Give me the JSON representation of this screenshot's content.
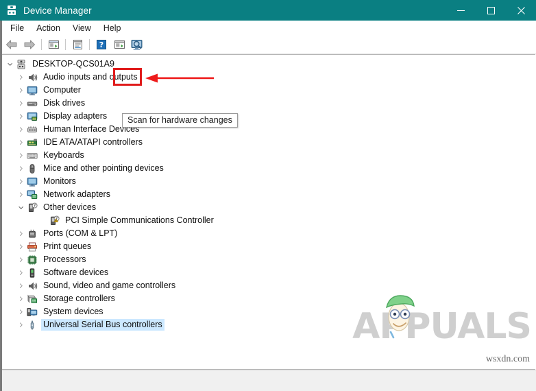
{
  "window": {
    "title": "Device Manager",
    "title_icon": "device-manager-icon",
    "accent_color": "#0a7f82",
    "controls": {
      "minimize": "minimize-button",
      "maximize": "maximize-button",
      "close": "close-button"
    }
  },
  "menubar": {
    "items": [
      {
        "label": "File"
      },
      {
        "label": "Action"
      },
      {
        "label": "View"
      },
      {
        "label": "Help"
      }
    ]
  },
  "toolbar": {
    "buttons": [
      {
        "name": "back-button",
        "icon": "back-arrow-icon"
      },
      {
        "name": "forward-button",
        "icon": "forward-arrow-icon"
      },
      {
        "name": "separator-1",
        "icon": "separator"
      },
      {
        "name": "show-hide-console-tree-button",
        "icon": "console-tree-icon"
      },
      {
        "name": "separator-2",
        "icon": "separator"
      },
      {
        "name": "properties-button",
        "icon": "properties-icon"
      },
      {
        "name": "separator-3",
        "icon": "separator"
      },
      {
        "name": "help-button",
        "icon": "question-mark-icon"
      },
      {
        "name": "update-driver-button",
        "icon": "update-driver-icon"
      },
      {
        "name": "scan-for-hardware-changes-button",
        "icon": "scan-hardware-icon"
      }
    ]
  },
  "tooltip": {
    "text": "Scan for hardware changes",
    "visible": true
  },
  "annotation": {
    "highlight_color": "#e01b1b",
    "target": "scan-for-hardware-changes-button",
    "arrow_direction": "left"
  },
  "tree": {
    "nodes": [
      {
        "label": "DESKTOP-QCS01A9",
        "depth": 0,
        "expander": "expanded",
        "icon": "computer-root-icon",
        "selected": false,
        "warning": false
      },
      {
        "label": "Audio inputs and outputs",
        "depth": 1,
        "expander": "collapsed",
        "icon": "speaker-icon",
        "selected": false,
        "warning": false
      },
      {
        "label": "Computer",
        "depth": 1,
        "expander": "collapsed",
        "icon": "monitor-icon",
        "selected": false,
        "warning": false
      },
      {
        "label": "Disk drives",
        "depth": 1,
        "expander": "collapsed",
        "icon": "disk-drive-icon",
        "selected": false,
        "warning": false
      },
      {
        "label": "Display adapters",
        "depth": 1,
        "expander": "collapsed",
        "icon": "display-adapter-icon",
        "selected": false,
        "warning": false
      },
      {
        "label": "Human Interface Devices",
        "depth": 1,
        "expander": "collapsed",
        "icon": "hid-icon",
        "selected": false,
        "warning": false
      },
      {
        "label": "IDE ATA/ATAPI controllers",
        "depth": 1,
        "expander": "collapsed",
        "icon": "ide-controller-icon",
        "selected": false,
        "warning": false
      },
      {
        "label": "Keyboards",
        "depth": 1,
        "expander": "collapsed",
        "icon": "keyboard-icon",
        "selected": false,
        "warning": false
      },
      {
        "label": "Mice and other pointing devices",
        "depth": 1,
        "expander": "collapsed",
        "icon": "mouse-icon",
        "selected": false,
        "warning": false
      },
      {
        "label": "Monitors",
        "depth": 1,
        "expander": "collapsed",
        "icon": "monitor-icon",
        "selected": false,
        "warning": false
      },
      {
        "label": "Network adapters",
        "depth": 1,
        "expander": "collapsed",
        "icon": "network-adapter-icon",
        "selected": false,
        "warning": false
      },
      {
        "label": "Other devices",
        "depth": 1,
        "expander": "expanded",
        "icon": "unknown-device-icon",
        "selected": false,
        "warning": false
      },
      {
        "label": "PCI Simple Communications Controller",
        "depth": 2,
        "expander": "none",
        "icon": "unknown-device-icon",
        "selected": false,
        "warning": true
      },
      {
        "label": "Ports (COM & LPT)",
        "depth": 1,
        "expander": "collapsed",
        "icon": "port-icon",
        "selected": false,
        "warning": false
      },
      {
        "label": "Print queues",
        "depth": 1,
        "expander": "collapsed",
        "icon": "printer-icon",
        "selected": false,
        "warning": false
      },
      {
        "label": "Processors",
        "depth": 1,
        "expander": "collapsed",
        "icon": "processor-icon",
        "selected": false,
        "warning": false
      },
      {
        "label": "Software devices",
        "depth": 1,
        "expander": "collapsed",
        "icon": "software-device-icon",
        "selected": false,
        "warning": false
      },
      {
        "label": "Sound, video and game controllers",
        "depth": 1,
        "expander": "collapsed",
        "icon": "speaker-icon",
        "selected": false,
        "warning": false
      },
      {
        "label": "Storage controllers",
        "depth": 1,
        "expander": "collapsed",
        "icon": "storage-controller-icon",
        "selected": false,
        "warning": false
      },
      {
        "label": "System devices",
        "depth": 1,
        "expander": "collapsed",
        "icon": "system-device-icon",
        "selected": false,
        "warning": false
      },
      {
        "label": "Universal Serial Bus controllers",
        "depth": 1,
        "expander": "collapsed",
        "icon": "usb-icon",
        "selected": true,
        "warning": false
      }
    ],
    "selection_color": "#cce8ff"
  },
  "statusbar": {
    "text": ""
  },
  "watermark": {
    "brand": "APPUALS",
    "source": "wsxdn.com"
  }
}
